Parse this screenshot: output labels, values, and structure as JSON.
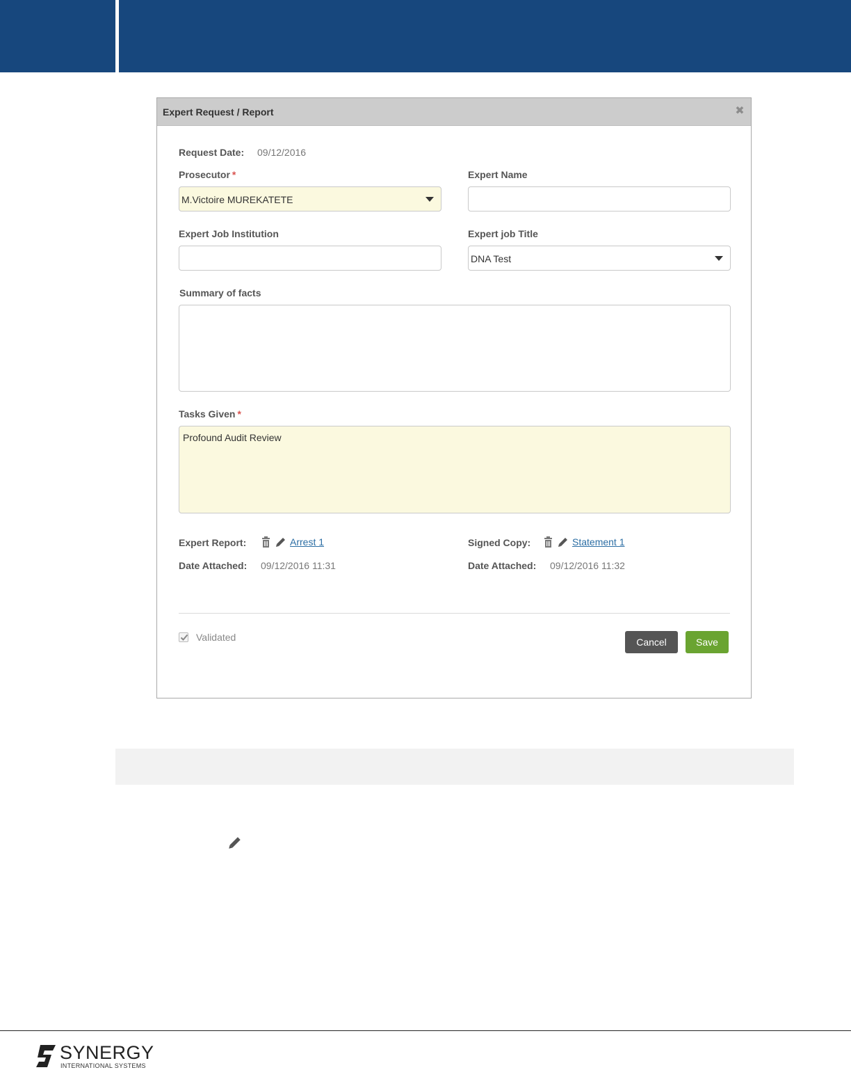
{
  "modal": {
    "title": "Expert Request / Report",
    "close_icon": "close-icon"
  },
  "form": {
    "request_date_label": "Request Date:",
    "request_date_value": "09/12/2016",
    "prosecutor_label": "Prosecutor",
    "prosecutor_value": "M.Victoire MUREKATETE",
    "expert_name_label": "Expert Name",
    "expert_name_value": "",
    "expert_job_institution_label": "Expert Job Institution",
    "expert_job_institution_value": "",
    "expert_job_title_label": "Expert job Title",
    "expert_job_title_value": "DNA Test",
    "summary_label": "Summary of facts",
    "summary_value": "",
    "tasks_label": "Tasks Given",
    "tasks_value": "Profound Audit Review",
    "required_marker": "*"
  },
  "attachments": {
    "expert_report_label": "Expert Report:",
    "expert_report_link": "Arrest 1",
    "expert_report_date_label": "Date Attached:",
    "expert_report_date": "09/12/2016 11:31",
    "signed_copy_label": "Signed Copy:",
    "signed_copy_link": "Statement 1",
    "signed_copy_date_label": "Date Attached:",
    "signed_copy_date": "09/12/2016 11:32"
  },
  "footer": {
    "validated_label": "Validated",
    "validated_checked": true,
    "cancel_label": "Cancel",
    "save_label": "Save"
  },
  "brand": {
    "logo_text": "SYNERGY",
    "logo_subtext": "INTERNATIONAL SYSTEMS"
  },
  "colors": {
    "header_blue": "#17477d",
    "required_yellow": "#fbf9df",
    "save_green": "#6aa431",
    "cancel_gray": "#555555",
    "link_blue": "#2c6ea4"
  }
}
